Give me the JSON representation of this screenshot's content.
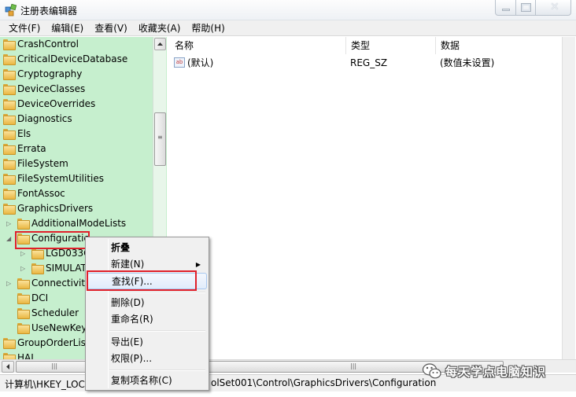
{
  "window": {
    "title": "注册表编辑器"
  },
  "menu": [
    "文件(F)",
    "编辑(E)",
    "查看(V)",
    "收藏夹(A)",
    "帮助(H)"
  ],
  "tree": {
    "items": [
      {
        "label": "CrashControl",
        "level": 0
      },
      {
        "label": "CriticalDeviceDatabase",
        "level": 0
      },
      {
        "label": "Cryptography",
        "level": 0
      },
      {
        "label": "DeviceClasses",
        "level": 0
      },
      {
        "label": "DeviceOverrides",
        "level": 0
      },
      {
        "label": "Diagnostics",
        "level": 0
      },
      {
        "label": "Els",
        "level": 0
      },
      {
        "label": "Errata",
        "level": 0
      },
      {
        "label": "FileSystem",
        "level": 0
      },
      {
        "label": "FileSystemUtilities",
        "level": 0
      },
      {
        "label": "FontAssoc",
        "level": 0
      },
      {
        "label": "GraphicsDrivers",
        "level": 0
      },
      {
        "label": "AdditionalModeLists",
        "level": 1
      },
      {
        "label": "Configuratic",
        "level": 1
      },
      {
        "label": "LGD033C",
        "level": 2
      },
      {
        "label": "SIMULAT",
        "level": 2
      },
      {
        "label": "Connectivity",
        "level": 1
      },
      {
        "label": "DCI",
        "level": 1
      },
      {
        "label": "Scheduler",
        "level": 1
      },
      {
        "label": "UseNewKey",
        "level": 1
      },
      {
        "label": "GroupOrderList",
        "level": 0
      },
      {
        "label": "HAL",
        "level": 0
      }
    ]
  },
  "columns": {
    "name": "名称",
    "type": "类型",
    "data": "数据"
  },
  "values": [
    {
      "name": "(默认)",
      "type": "REG_SZ",
      "data": "(数值未设置)",
      "icon": "ab-icon"
    }
  ],
  "context_menu": {
    "collapse": "折叠",
    "new": "新建(N)",
    "find": "查找(F)...",
    "delete": "删除(D)",
    "rename": "重命名(R)",
    "export": "导出(E)",
    "permissions": "权限(P)...",
    "copy_key_name": "复制项名称(C)"
  },
  "status": {
    "path_left": "计算机\\HKEY_LOCA",
    "path_right": "olSet001\\Control\\GraphicsDrivers\\Configuration"
  },
  "watermark": {
    "text": "每天学点电脑知识"
  },
  "colors": {
    "tree_bg": "#c6efce",
    "highlight": "#e0202a",
    "menu_bg": "#f0f0f0"
  }
}
